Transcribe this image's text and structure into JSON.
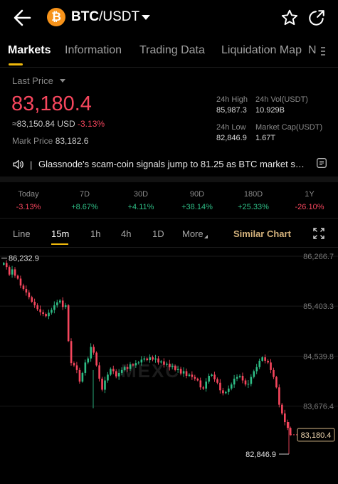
{
  "header": {
    "logo_glyph": "₿",
    "pair_base": "BTC",
    "pair_quote": "/USDT",
    "icons": [
      "back-arrow-icon",
      "bitcoin-logo-icon",
      "chevron-down-icon",
      "star-icon",
      "share-icon"
    ]
  },
  "tabs": [
    "Markets",
    "Information",
    "Trading Data",
    "Liquidation Map",
    "N"
  ],
  "ticker": {
    "last_label": "Last Price",
    "last_price": "83,180.4",
    "usd_value": "≈83,150.84",
    "usd_label": "USD",
    "change": "-3.13%",
    "mark_label": "Mark Price",
    "mark_value": "83,182.6",
    "high_label": "24h High",
    "high_value": "85,987.3",
    "vol_label": "24h Vol(USDT)",
    "vol_value": "10.929B",
    "low_label": "24h Low",
    "low_value": "82,846.9",
    "cap_label": "Market Cap(USDT)",
    "cap_value": "1.67T"
  },
  "news": {
    "separator": "|",
    "text": "Glassnode's scam-coin signals jump to 81.25 as BTC market shar..."
  },
  "performance": [
    {
      "label": "Today",
      "value": "-3.13%",
      "color": "#f6465d"
    },
    {
      "label": "7D",
      "value": "+8.67%",
      "color": "#2ebd85"
    },
    {
      "label": "30D",
      "value": "+4.11%",
      "color": "#2ebd85"
    },
    {
      "label": "90D",
      "value": "+38.14%",
      "color": "#2ebd85"
    },
    {
      "label": "180D",
      "value": "+25.33%",
      "color": "#2ebd85"
    },
    {
      "label": "1Y",
      "value": "-26.10%",
      "color": "#f6465d"
    }
  ],
  "chart_toolbar": {
    "items": [
      "Line",
      "15m",
      "1h",
      "4h",
      "1D",
      "More"
    ],
    "active": "15m",
    "similar": "Similar Chart"
  },
  "chart_data": {
    "type": "candlestick",
    "interval": "15m",
    "y_ticks": [
      "86,266.7",
      "85,403.3",
      "84,539.8",
      "83,676.4"
    ],
    "ylim": [
      82700,
      86400
    ],
    "watermark": "MEXC",
    "high_marker": "86,232.9",
    "low_marker": "82,846.9",
    "last_marker": "83,180.4",
    "colors": {
      "up": "#2ebd85",
      "down": "#f6465d"
    },
    "close_path": [
      86150,
      86080,
      85950,
      86040,
      85930,
      85880,
      85760,
      85700,
      85640,
      85560,
      85480,
      85420,
      85350,
      85300,
      85270,
      85230,
      85290,
      85340,
      85420,
      85470,
      85500,
      85390,
      85420,
      84800,
      84420,
      84380,
      84300,
      84100,
      84250,
      84430,
      84500,
      84700,
      84600,
      84380,
      84150,
      83960,
      84120,
      84220,
      84320,
      84280,
      84190,
      84250,
      84300,
      84350,
      84320,
      84400,
      84380,
      84420,
      84430,
      84480,
      84500,
      84470,
      84520,
      84480,
      84500,
      84430,
      84450,
      84390,
      84410,
      84350,
      84370,
      84300,
      84320,
      84240,
      84280,
      84200,
      84220,
      84180,
      84150,
      84120,
      84000,
      83980,
      84100,
      84200,
      84220,
      84140,
      84080,
      83950,
      83900,
      83920,
      83980,
      84050,
      84150,
      84180,
      84200,
      84120,
      84050,
      84060,
      84180,
      84280,
      84350,
      84460,
      84520,
      84460,
      84430,
      84300,
      84180,
      84000,
      83700,
      83550,
      83400,
      83300,
      83180.4
    ]
  }
}
